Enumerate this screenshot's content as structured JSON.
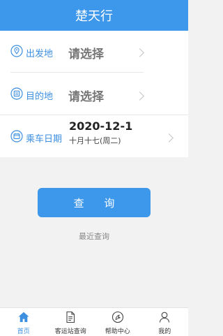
{
  "header": {
    "title": "楚天行"
  },
  "form": {
    "departure": {
      "label": "出发地",
      "value": "请选择"
    },
    "destination": {
      "label": "目的地",
      "value": "请选择"
    },
    "date": {
      "label": "乘车日期",
      "value": "2020-12-1",
      "lunar": "十月十七(周二)"
    }
  },
  "actions": {
    "query": "查 询",
    "recent": "最近查询"
  },
  "tabbar": [
    {
      "label": "首页",
      "icon": "home-icon",
      "active": true
    },
    {
      "label": "客运站查询",
      "icon": "document-icon",
      "active": false
    },
    {
      "label": "帮助中心",
      "icon": "help-icon",
      "active": false
    },
    {
      "label": "我的",
      "icon": "user-icon",
      "active": false
    }
  ],
  "colors": {
    "primary": "#3d97ea",
    "label": "#3d8fe0",
    "background": "#f2f2f2"
  }
}
